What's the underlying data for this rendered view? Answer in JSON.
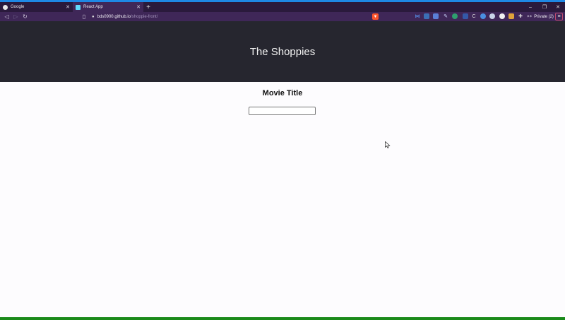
{
  "browser": {
    "tabs": [
      {
        "title": "Google",
        "active": false,
        "icon": "google-icon"
      },
      {
        "title": "React App",
        "active": true,
        "icon": "react-icon"
      }
    ],
    "new_tab_glyph": "+",
    "window_controls": {
      "minimize": "–",
      "restore": "❐",
      "close": "✕"
    },
    "address": {
      "host": "bds0900.github.io",
      "path": "/shoppie-front/"
    },
    "private_label": "Private (2)",
    "colors": {
      "accent": "#1e88e5",
      "tabstrip": "#2a1a3c",
      "toolbar": "#3f2758",
      "brave": "#fb542b"
    }
  },
  "page": {
    "header_title": "The Shoppies",
    "search_heading": "Movie Title",
    "search_value": "",
    "colors": {
      "header_bg": "#26262f",
      "bottom_bar": "#1a8a1a"
    }
  }
}
